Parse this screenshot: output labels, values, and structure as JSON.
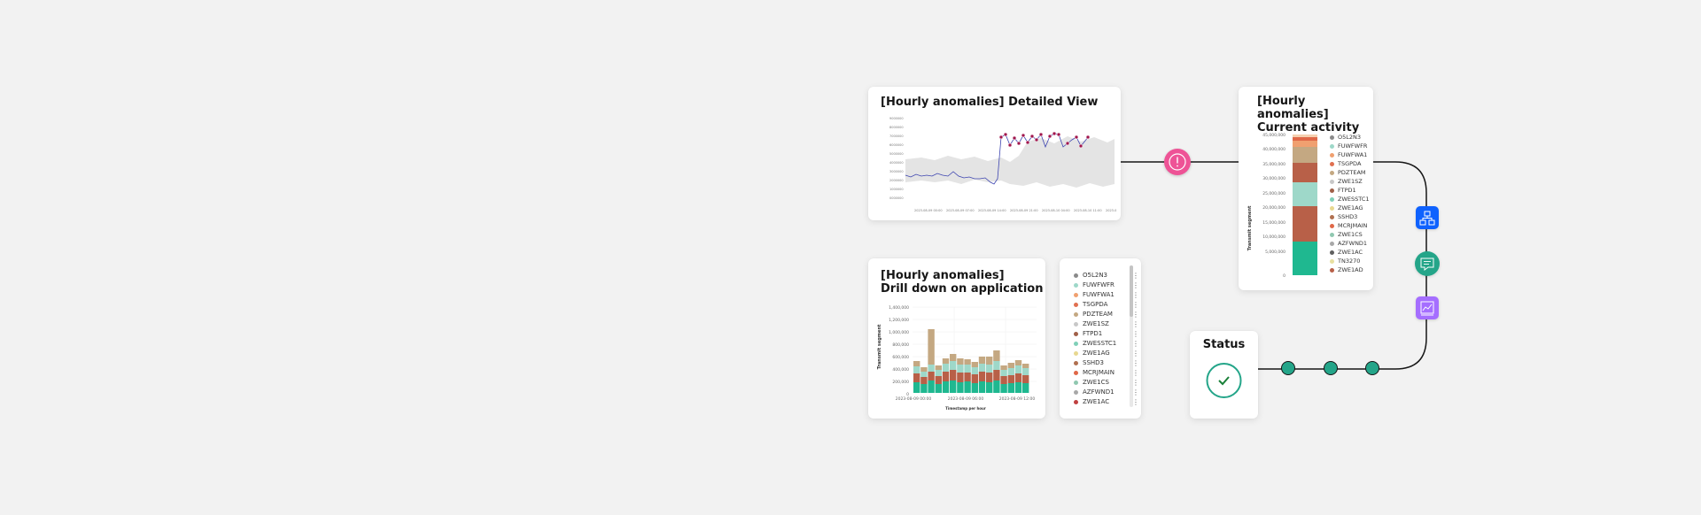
{
  "detailed": {
    "title": "[Hourly anomalies] Detailed View",
    "y_ticks": [
      "9000000",
      "8000000",
      "7000000",
      "6000000",
      "5000000",
      "4000000",
      "3000000",
      "2000000",
      "1000000",
      "0000000"
    ],
    "x_ticks": [
      "2023-08-09 00:00",
      "2023-08-09 07:00",
      "2023-08-09 14:00",
      "2023-08-09 21:00",
      "2023-08-10 04:00",
      "2023-08-10 11:00",
      "2023-0"
    ]
  },
  "current": {
    "title_line1": "[Hourly anomalies]",
    "title_line2": "Current activity",
    "ylabel": "Transmit segment",
    "y_ticks": [
      "45,000,000",
      "40,000,000",
      "35,000,000",
      "30,000,000",
      "25,000,000",
      "20,000,000",
      "15,000,000",
      "10,000,000",
      "5,000,000",
      "0"
    ],
    "legend": [
      "O5L2N3",
      "FUWFWFR",
      "FUWFWA1",
      "TSGPDA",
      "PDZTEAM",
      "ZWE1SZ",
      "FTPD1",
      "ZWESSTC1",
      "ZWE1AG",
      "SSHD3",
      "MCRJMAIN",
      "ZWE1CS",
      "AZFWND1",
      "ZWE1AC",
      "TN3270",
      "ZWE1AD"
    ],
    "colors": [
      "#8a8a8a",
      "#9ed8c9",
      "#f0a070",
      "#e07050",
      "#c4a882",
      "#c8c8c8",
      "#a06048",
      "#80d0b8",
      "#e8d890",
      "#b07050",
      "#e06848",
      "#90c8b0",
      "#a8a8a8",
      "#606060",
      "#e8e0a0",
      "#b86048"
    ]
  },
  "drill": {
    "title_line1": "[Hourly anomalies]",
    "title_line2": "Drill down on application",
    "ylabel": "Transmit segment",
    "xlabel": "Timestamp per hour",
    "y_ticks": [
      "1,400,000",
      "1,200,000",
      "1,000,000",
      "800,000",
      "600,000",
      "400,000",
      "200,000",
      "0"
    ],
    "x_ticks": [
      "2023-08-09 00:00",
      "2023-08-09 06:00",
      "2023-08-09 12:00"
    ]
  },
  "legend_list": {
    "items": [
      "O5L2N3",
      "FUWFWFR",
      "FUWFWA1",
      "TSGPDA",
      "PDZTEAM",
      "ZWE1SZ",
      "FTPD1",
      "ZWESSTC1",
      "ZWE1AG",
      "SSHD3",
      "MCRJMAIN",
      "ZWE1CS",
      "AZFWND1",
      "ZWE1AC"
    ],
    "colors": [
      "#8a8a8a",
      "#9ed8c9",
      "#f0a070",
      "#e07050",
      "#c4a882",
      "#c8c8c8",
      "#a06048",
      "#80d0b8",
      "#e8d890",
      "#b07050",
      "#e06848",
      "#90c8b0",
      "#a8a8a8",
      "#c04040"
    ]
  },
  "status": {
    "title": "Status"
  },
  "icons": {
    "alert": "warning-alert-icon",
    "hierarchy": "flow-hierarchy-icon",
    "chat": "chat-message-icon",
    "chart": "line-chart-icon",
    "check": "checkmark-icon"
  },
  "accent_colors": {
    "pink": "#ee5396",
    "blue": "#0f62fe",
    "teal": "#24a589",
    "purple": "#a56eff",
    "status_green": "#198038"
  }
}
